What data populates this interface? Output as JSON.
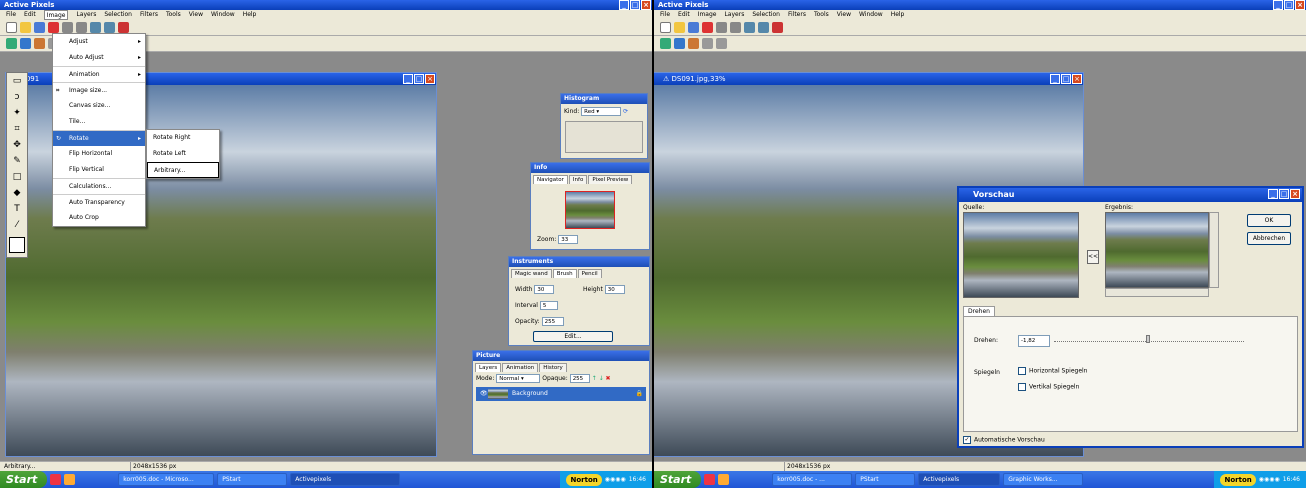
{
  "left": {
    "app_title": "Active Pixels",
    "menu": [
      "File",
      "Edit",
      "Image",
      "Layers",
      "Selection",
      "Filters",
      "Tools",
      "View",
      "Window",
      "Help"
    ],
    "doc_title": "DS091",
    "image_menu": [
      {
        "label": "Adjust",
        "sub": true
      },
      {
        "label": "Auto Adjust",
        "sub": true
      },
      {
        "label": "Animation",
        "sub": true
      },
      {
        "label": "Image size..."
      },
      {
        "label": "Canvas size..."
      },
      {
        "label": "Tile..."
      },
      {
        "label": "Rotate",
        "sub": true
      },
      {
        "label": "Flip Horizontal"
      },
      {
        "label": "Flip Vertical"
      },
      {
        "label": "Calculations..."
      },
      {
        "label": "Auto Transparency"
      },
      {
        "label": "Auto Crop"
      }
    ],
    "rotate_submenu": [
      "Rotate Right",
      "Rotate Left",
      "Arbitrary..."
    ],
    "histogram": {
      "title": "Histogram",
      "kind_label": "Kind:",
      "kind_value": "Red"
    },
    "info": {
      "title": "Info",
      "tabs": [
        "Navigator",
        "Info",
        "Pixel Preview"
      ],
      "zoom_label": "Zoom:",
      "zoom_value": "33"
    },
    "instruments": {
      "title": "Instruments",
      "tabs": [
        "Magic wand",
        "Brush",
        "Pencil"
      ],
      "width_label": "Width",
      "width_value": "30",
      "height_label": "Height",
      "height_value": "30",
      "interval_label": "Interval",
      "interval_value": "5",
      "opacity_label": "Opacity:",
      "opacity_value": "255",
      "edit_label": "Edit..."
    },
    "picture": {
      "title": "Picture",
      "tabs": [
        "Layers",
        "Animation",
        "History"
      ],
      "mode_label": "Mode:",
      "mode_value": "Normal",
      "opaque_label": "Opaque:",
      "opaque_value": "255",
      "layer_name": "Background"
    },
    "status": {
      "text": "Arbitrary...",
      "size": "2048x1536 px"
    },
    "taskbar": {
      "start": "Start",
      "tasks": [
        "korr005.doc - Microso...",
        "PStart",
        "Activepixels"
      ],
      "norton": "Norton",
      "clock": "16:46"
    }
  },
  "right": {
    "app_title": "Active Pixels",
    "menu": [
      "File",
      "Edit",
      "Image",
      "Layers",
      "Selection",
      "Filters",
      "Tools",
      "View",
      "Window",
      "Help"
    ],
    "doc_title": "DS091.jpg,33%",
    "dialog": {
      "title": "Vorschau",
      "source_label": "Quelle:",
      "result_label": "Ergebnis:",
      "ok": "OK",
      "cancel": "Abbrechen",
      "swap": "<<",
      "tab": "Drehen",
      "rotate_label": "Drehen:",
      "rotate_value": "-1,82",
      "mirror_label": "Spiegeln",
      "mirror_h": "Horizontal Spiegeln",
      "mirror_v": "Vertikal Spiegeln",
      "auto_preview": "Automatische Vorschau"
    },
    "status": {
      "size": "2048x1536 px"
    },
    "taskbar": {
      "start": "Start",
      "tasks": [
        "korr005.doc - ...",
        "PStart",
        "Activepixels",
        "Graphic Works..."
      ],
      "norton": "Norton",
      "clock": "16:46"
    }
  }
}
